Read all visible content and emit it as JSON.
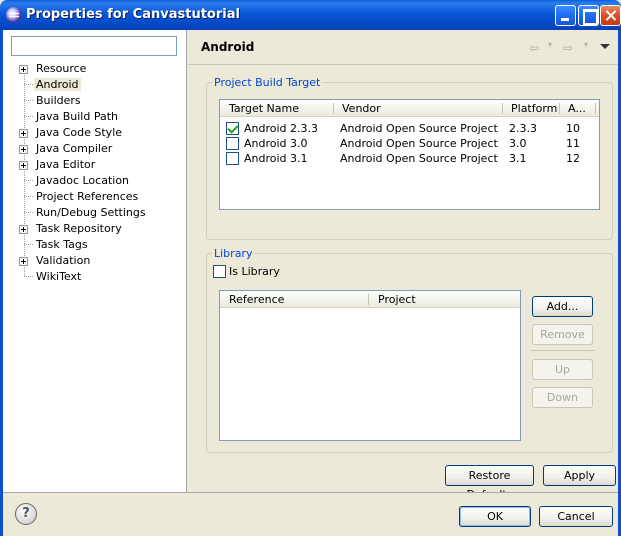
{
  "window": {
    "title": "Properties for Canvastutorial"
  },
  "filter": {
    "value": ""
  },
  "tree": {
    "items": [
      {
        "label": "Resource",
        "expandable": true
      },
      {
        "label": "Android",
        "expandable": false,
        "selected": true
      },
      {
        "label": "Builders",
        "expandable": false
      },
      {
        "label": "Java Build Path",
        "expandable": false
      },
      {
        "label": "Java Code Style",
        "expandable": true
      },
      {
        "label": "Java Compiler",
        "expandable": true
      },
      {
        "label": "Java Editor",
        "expandable": true
      },
      {
        "label": "Javadoc Location",
        "expandable": false
      },
      {
        "label": "Project References",
        "expandable": false
      },
      {
        "label": "Run/Debug Settings",
        "expandable": false
      },
      {
        "label": "Task Repository",
        "expandable": true
      },
      {
        "label": "Task Tags",
        "expandable": false
      },
      {
        "label": "Validation",
        "expandable": true
      },
      {
        "label": "WikiText",
        "expandable": false
      }
    ]
  },
  "page": {
    "title": "Android"
  },
  "build_target": {
    "group_title": "Project Build Target",
    "columns": [
      "Target Name",
      "Vendor",
      "Platform",
      "A..."
    ],
    "rows": [
      {
        "name": "Android 2.3.3",
        "vendor": "Android Open Source Project",
        "platform": "2.3.3",
        "api": "10",
        "checked": true
      },
      {
        "name": "Android 3.0",
        "vendor": "Android Open Source Project",
        "platform": "3.0",
        "api": "11",
        "checked": false
      },
      {
        "name": "Android 3.1",
        "vendor": "Android Open Source Project",
        "platform": "3.1",
        "api": "12",
        "checked": false
      }
    ]
  },
  "library": {
    "group_title": "Library",
    "is_library_label": "Is Library",
    "is_library_checked": false,
    "columns": [
      "Reference",
      "Project"
    ],
    "buttons": {
      "add": "Add...",
      "remove": "Remove",
      "up": "Up",
      "down": "Down"
    }
  },
  "page_buttons": {
    "restore_defaults": "Restore Defaults",
    "apply": "Apply"
  },
  "dialog_buttons": {
    "ok": "OK",
    "cancel": "Cancel"
  },
  "help": {
    "glyph": "?"
  }
}
